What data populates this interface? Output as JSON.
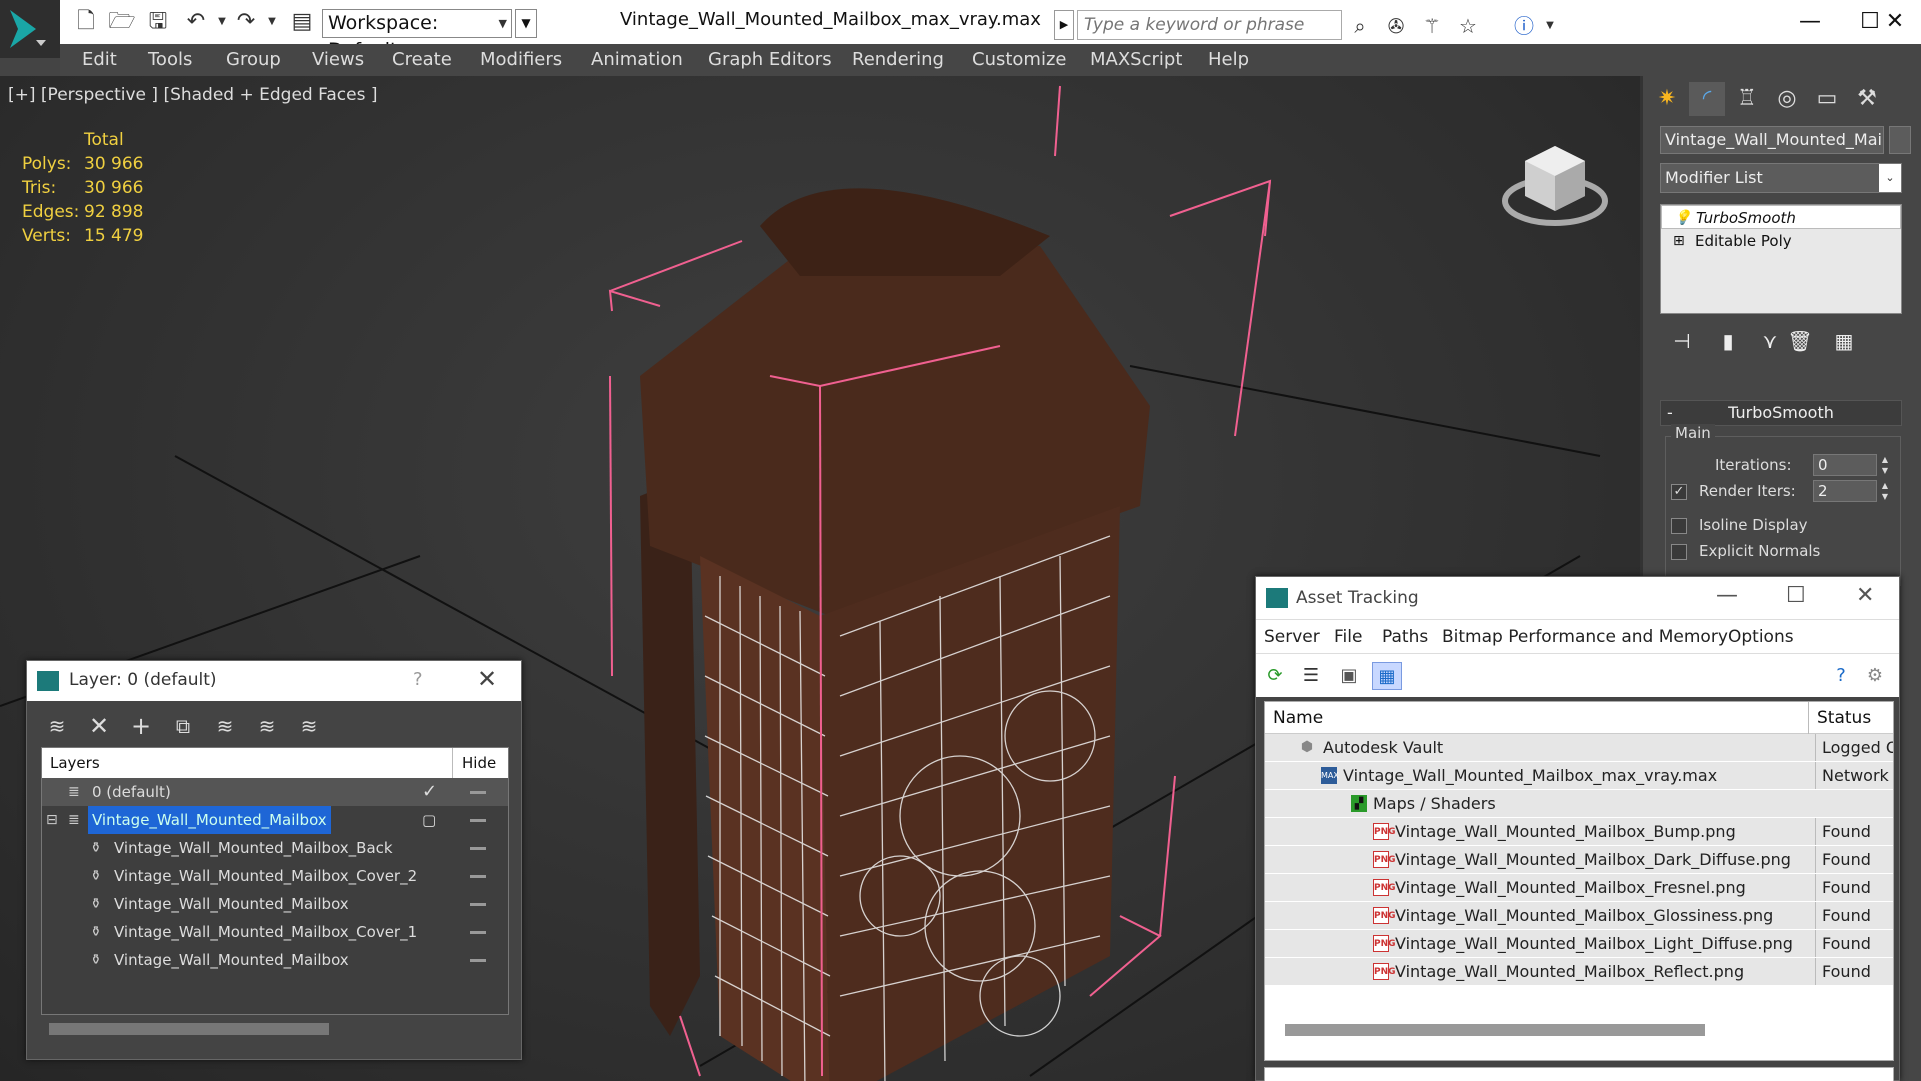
{
  "titlebar": {
    "workspace": "Workspace: Default",
    "document_title": "Vintage_Wall_Mounted_Mailbox_max_vray.max",
    "search_placeholder": "Type a keyword or phrase"
  },
  "menubar": {
    "items": [
      "Edit",
      "Tools",
      "Group",
      "Views",
      "Create",
      "Modifiers",
      "Animation",
      "Graph Editors",
      "Rendering",
      "Customize",
      "MAXScript",
      "Help"
    ]
  },
  "viewport": {
    "label": "[+] [Perspective ] [Shaded + Edged Faces ]",
    "stats": {
      "header": "Total",
      "rows": [
        {
          "key": "Polys:",
          "value": "30 966"
        },
        {
          "key": "Tris:",
          "value": "30 966"
        },
        {
          "key": "Edges:",
          "value": "92 898"
        },
        {
          "key": "Verts:",
          "value": "15 479"
        }
      ]
    }
  },
  "command_panel": {
    "object_name": "Vintage_Wall_Mounted_Mailbox",
    "modifier_list": "Modifier List",
    "stack": [
      "TurboSmooth",
      "Editable Poly"
    ],
    "rollout": {
      "title": "TurboSmooth",
      "group": "Main",
      "iterations_label": "Iterations:",
      "iterations_value": "0",
      "render_iters_label": "Render Iters:",
      "render_iters_value": "2",
      "isoline_label": "Isoline Display",
      "explicit_label": "Explicit Normals"
    }
  },
  "layer_explorer": {
    "title": "Layer: 0 (default)",
    "help": "?",
    "col_layers": "Layers",
    "col_hide": "Hide",
    "rows": [
      {
        "label": "0 (default)"
      },
      {
        "label": "Vintage_Wall_Mounted_Mailbox"
      },
      {
        "label": "Vintage_Wall_Mounted_Mailbox_Back"
      },
      {
        "label": "Vintage_Wall_Mounted_Mailbox_Cover_2"
      },
      {
        "label": "Vintage_Wall_Mounted_Mailbox"
      },
      {
        "label": "Vintage_Wall_Mounted_Mailbox_Cover_1"
      },
      {
        "label": "Vintage_Wall_Mounted_Mailbox"
      }
    ]
  },
  "asset_tracking": {
    "title": "Asset Tracking",
    "menu": [
      "Server",
      "File",
      "Paths",
      "Bitmap Performance and Memory",
      "Options"
    ],
    "col_name": "Name",
    "col_status": "Status",
    "rows": [
      {
        "name": "Autodesk Vault",
        "status": "Logged Ou"
      },
      {
        "name": "Vintage_Wall_Mounted_Mailbox_max_vray.max",
        "status": "Network Pa"
      },
      {
        "name": "Maps / Shaders",
        "status": ""
      },
      {
        "name": "Vintage_Wall_Mounted_Mailbox_Bump.png",
        "status": "Found"
      },
      {
        "name": "Vintage_Wall_Mounted_Mailbox_Dark_Diffuse.png",
        "status": "Found"
      },
      {
        "name": "Vintage_Wall_Mounted_Mailbox_Fresnel.png",
        "status": "Found"
      },
      {
        "name": "Vintage_Wall_Mounted_Mailbox_Glossiness.png",
        "status": "Found"
      },
      {
        "name": "Vintage_Wall_Mounted_Mailbox_Light_Diffuse.png",
        "status": "Found"
      },
      {
        "name": "Vintage_Wall_Mounted_Mailbox_Reflect.png",
        "status": "Found"
      }
    ],
    "png_badge": "PNG"
  }
}
